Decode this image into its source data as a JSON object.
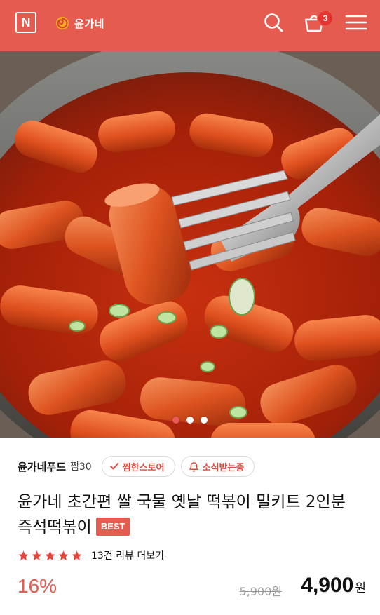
{
  "header": {
    "logo_letter": "N",
    "brand_name": "윤가네",
    "cart_count": "3",
    "accent_color": "#e55b4f"
  },
  "hero": {
    "image_icon": "tteokbokki-photo",
    "slide_count": 3,
    "active_slide": 1
  },
  "product": {
    "seller": "윤가네푸드",
    "zzim": "찜30",
    "chip_store": "찜한스토어",
    "chip_notify": "소식받는중",
    "title": "윤가네 초간편 쌀 국물 옛날 떡볶이 밀키트 2인분 즉석떡볶이",
    "badge": "BEST",
    "rating_stars": 5,
    "review_link": "13건 리뷰 더보기",
    "discount": "16%",
    "original_price": "5,900원",
    "price": "4,900",
    "currency": "원"
  }
}
